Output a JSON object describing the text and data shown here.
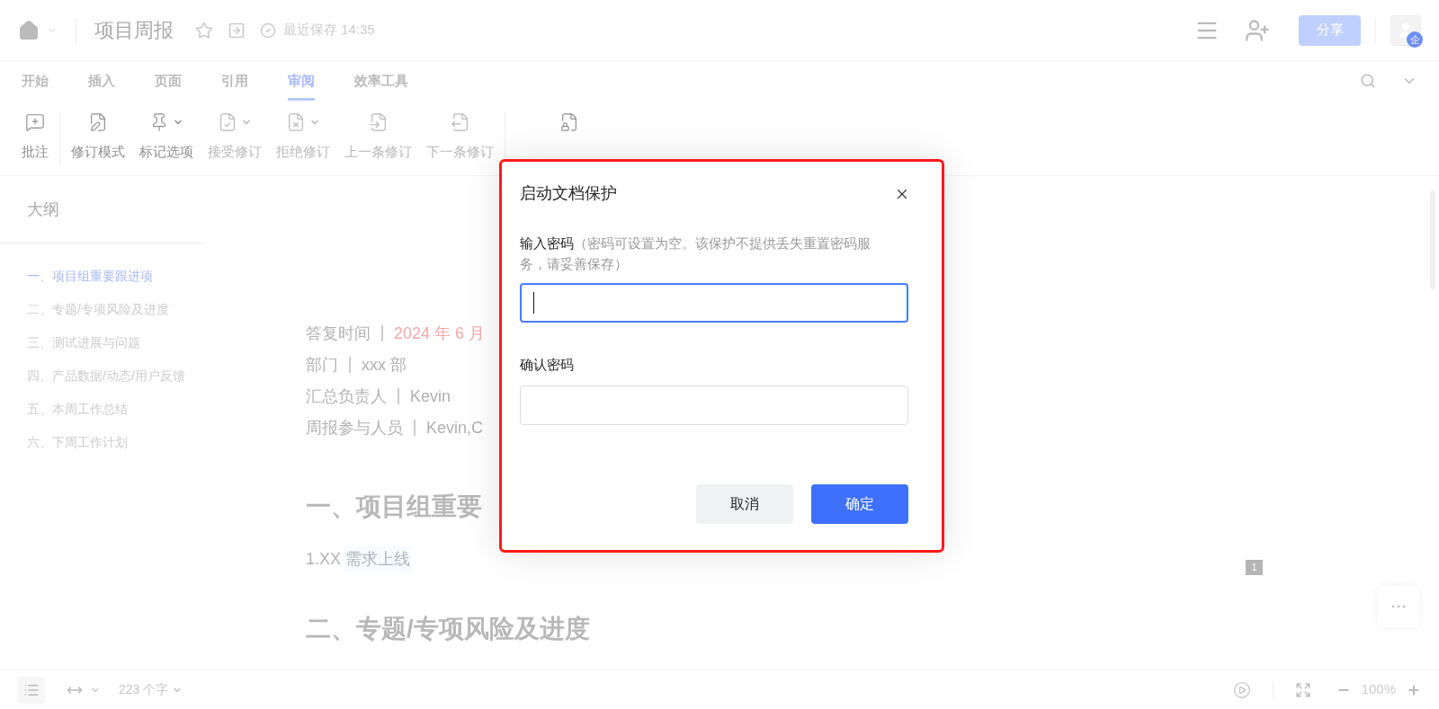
{
  "header": {
    "title": "项目周报",
    "save_status": "最近保存 14:35",
    "share_button": "分享",
    "avatar_badge": "企"
  },
  "tabs": [
    {
      "label": "开始",
      "selected": false
    },
    {
      "label": "插入",
      "selected": false
    },
    {
      "label": "页面",
      "selected": false
    },
    {
      "label": "引用",
      "selected": false
    },
    {
      "label": "审阅",
      "selected": true
    },
    {
      "label": "效率工具",
      "selected": false
    }
  ],
  "toolbar": [
    {
      "label": "批注",
      "kind": "comment",
      "disabled": false,
      "dropdown": false
    },
    {
      "label": "修订模式",
      "kind": "track",
      "disabled": false,
      "dropdown": false
    },
    {
      "label": "标记选项",
      "kind": "mark",
      "disabled": false,
      "dropdown": true
    },
    {
      "label": "接受修订",
      "kind": "accept",
      "disabled": true,
      "dropdown": true
    },
    {
      "label": "拒绝修订",
      "kind": "reject",
      "disabled": true,
      "dropdown": true
    },
    {
      "label": "上一条修订",
      "kind": "prev",
      "disabled": true,
      "dropdown": false
    },
    {
      "label": "下一条修订",
      "kind": "next",
      "disabled": true,
      "dropdown": false
    },
    {
      "kind": "lock",
      "disabled": false,
      "dropdown": false
    }
  ],
  "outline": {
    "title": "大纲",
    "items": [
      {
        "label": "一、项目组重要跟进项",
        "selected": true
      },
      {
        "label": "二、专题/专项风险及进度",
        "selected": false
      },
      {
        "label": "三、测试进展与问题",
        "selected": false
      },
      {
        "label": "四、产品数据/动态/用户反馈",
        "selected": false
      },
      {
        "label": "五、本周工作总结",
        "selected": false
      },
      {
        "label": "六、下周工作计划",
        "selected": false
      }
    ]
  },
  "document": {
    "meta": [
      {
        "label": "答复时间",
        "value": "2024 年 6 月",
        "color": "#f0a8a8"
      },
      {
        "label": "部门",
        "value": "xxx 部",
        "color": "#b0b0b0"
      },
      {
        "label": "汇总负责人",
        "value": "Kevin",
        "color": "#b0b0b0"
      },
      {
        "label": "周报参与人员",
        "value": "Kevin,C",
        "color": "#b0b0b0"
      }
    ],
    "heading_1": "一、项目组重要",
    "item_number": "1.XX",
    "item_text": "需求上线",
    "page_badge": "1",
    "heading_2": "二、专题/专项风险及进度"
  },
  "status_bar": {
    "word_count": "223 个字",
    "zoom": "100%"
  },
  "dialog": {
    "title": "启动文档保护",
    "password_label": "输入密码",
    "password_hint": "（密码可设置为空。该保护不提供丢失重置密码服务，请妥善保存）",
    "confirm_label": "确认密码",
    "cancel_button": "取消",
    "ok_button": "确定"
  }
}
